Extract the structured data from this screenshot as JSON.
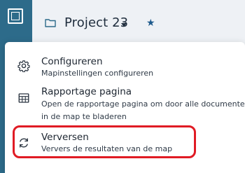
{
  "header": {
    "project_title": "Project 23",
    "caret_icon": "caret-down-icon",
    "star_icon": "star-icon",
    "folder_icon": "folder-icon"
  },
  "left_rail": {
    "app_icon": "square-app-icon"
  },
  "menu": {
    "items": [
      {
        "icon": "gear-icon",
        "title": "Configureren",
        "description": "Mapinstellingen configureren"
      },
      {
        "icon": "table-icon",
        "title": "Rapportage pagina",
        "description_line1": "Open de rapportage pagina om door alle documenten",
        "description_line2": "in de map te bladeren"
      },
      {
        "icon": "refresh-icon",
        "title": "Verversen",
        "description": "Ververs de resultaten van de map",
        "highlighted": true
      }
    ]
  },
  "colors": {
    "rail": "#2d6b8a",
    "accent_star": "#1e5a8c",
    "highlight": "#e01b24"
  }
}
